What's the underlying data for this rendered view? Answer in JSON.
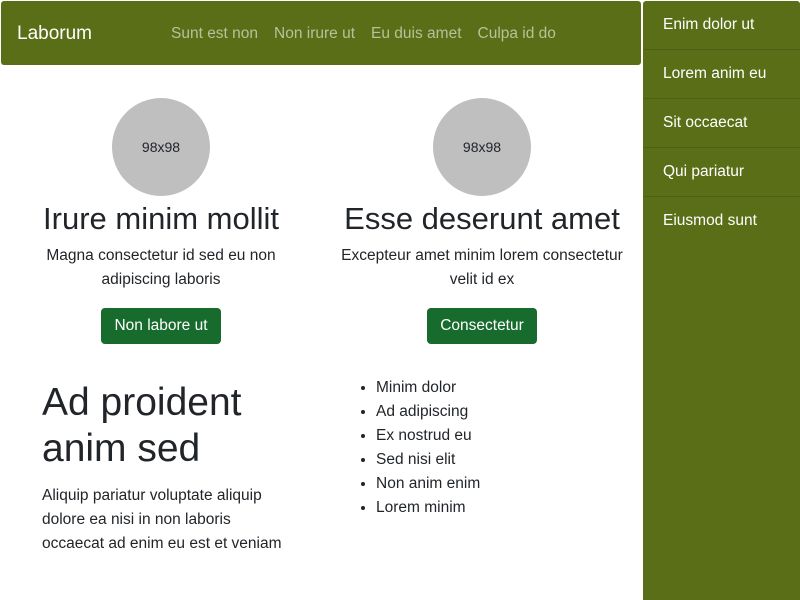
{
  "navbar": {
    "brand": "Laborum",
    "links": [
      "Sunt est non",
      "Non irure ut",
      "Eu duis amet",
      "Culpa id do"
    ]
  },
  "sidebar": {
    "items": [
      "Enim dolor ut",
      "Lorem anim eu",
      "Sit occaecat",
      "Qui pariatur",
      "Eiusmod sunt"
    ]
  },
  "cards": [
    {
      "avatar_text": "98x98",
      "title": "Irure minim mollit",
      "text": "Magna consectetur id sed eu non adipiscing laboris",
      "button": "Non labore ut"
    },
    {
      "avatar_text": "98x98",
      "title": "Esse deserunt amet",
      "text": "Excepteur amet minim lorem consectetur velit id ex",
      "button": "Consectetur"
    }
  ],
  "section": {
    "heading": "Ad proident anim sed",
    "paragraph": "Aliquip pariatur voluptate aliquip dolore ea nisi in non laboris occaecat ad enim eu est et veniam"
  },
  "list_items": [
    "Minim dolor",
    "Ad adipiscing",
    "Ex nostrud eu",
    "Sed nisi elit",
    "Non anim enim",
    "Lorem minim"
  ],
  "colors": {
    "navbar_bg": "#5a6e17",
    "button_bg": "#176b2c",
    "avatar_bg": "#bfbfbf"
  }
}
